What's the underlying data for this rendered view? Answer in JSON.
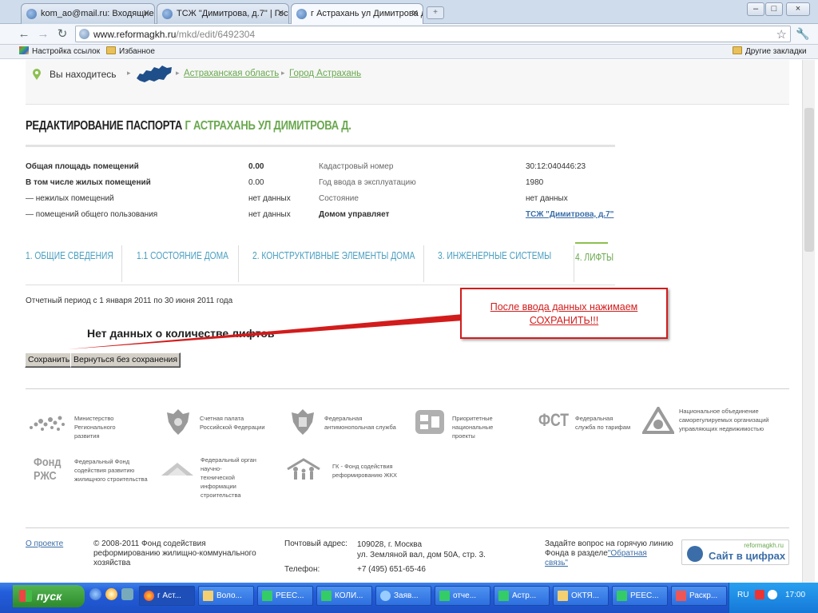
{
  "browser": {
    "tabs": [
      {
        "label": "kom_ao@mail.ru: Входящие"
      },
      {
        "label": "ТСЖ \"Димитрова, д.7\" | Госу"
      },
      {
        "label": "г Астрахань ул Димитрова д"
      }
    ],
    "url_host": "www.reformagkh.ru",
    "url_path": "/mkd/edit/6492304",
    "bookmarks": [
      {
        "label": "Настройка ссылок"
      },
      {
        "label": "Избанное"
      }
    ],
    "other_bookmarks": "Другие закладки",
    "window_buttons": [
      "–",
      "□",
      "×"
    ]
  },
  "breadcrumb": {
    "label": "Вы находитесь",
    "links": [
      "Астраханская область",
      "Город Астрахань"
    ]
  },
  "page": {
    "title_prefix": "РЕДАКТИРОВАНИЕ ПАСПОРТА",
    "title_address": "Г АСТРАХАНЬ УЛ ДИМИТРОВА Д.",
    "info_left": [
      {
        "label": "Общая площадь помещений",
        "value": "0.00",
        "bold": true
      },
      {
        "label": "В том числе жилых помещений",
        "value": "0.00",
        "bold": true
      },
      {
        "label": "— нежилых помещений",
        "value": "нет данных",
        "bold": false
      },
      {
        "label": "— помещений общего пользования",
        "value": "нет данных",
        "bold": false
      }
    ],
    "info_right": [
      {
        "label": "Кадастровый номер",
        "value": "30:12:040446:23"
      },
      {
        "label": "Год ввода в эксплуатацию",
        "value": "1980"
      },
      {
        "label": "Состояние",
        "value": "нет данных"
      },
      {
        "label": "Домом управляет",
        "value": "ТСЖ \"Димитрова, д.7\""
      }
    ],
    "tabs": [
      {
        "label": "1. ОБЩИЕ СВЕДЕНИЯ"
      },
      {
        "label": "1.1 СОСТОЯНИЕ ДОМА"
      },
      {
        "label": "2. КОНСТРУКТИВНЫЕ ЭЛЕМЕНТЫ ДОМА"
      },
      {
        "label": "3. ИНЖЕНЕРНЫЕ СИСТЕМЫ"
      },
      {
        "label": "4. ЛИФТЫ"
      }
    ],
    "period": "Отчетный период с 1 января 2011 по 30 июня 2011 года",
    "no_data": "Нет данных о количестве лифтов",
    "save_button": "Сохранить",
    "back_button": "Вернуться без сохранения"
  },
  "callout": {
    "line1": "После ввода данных нажимаем",
    "line2": "СОХРАНИТЬ!!!"
  },
  "partners": [
    {
      "lines": [
        "Министерство",
        "Регионального",
        "развития"
      ]
    },
    {
      "lines": [
        "Счетная палата",
        "Российской Федерации"
      ]
    },
    {
      "lines": [
        "Федеральная",
        "антимонопольная служба"
      ]
    },
    {
      "lines": [
        "Приоритетные",
        "национальные",
        "проекты"
      ]
    },
    {
      "lines": [
        "Федеральная",
        "служба по тарифам"
      ]
    },
    {
      "lines": [
        "Национальное объединение",
        "саморегулируемых организаций",
        "управляющих недвижимостью"
      ]
    },
    {
      "lines": [
        "Федеральный Фонд",
        "содействия развитию",
        "жилищного строительства"
      ]
    },
    {
      "lines": [
        "Федеральный орган",
        "научно-",
        "технической",
        "информации",
        "строительства"
      ]
    },
    {
      "lines": [
        "ГК - Фонд содействия",
        "реформированию ЖКХ"
      ]
    }
  ],
  "partner_logo_text": {
    "fst": "ФСТ",
    "rzhs": [
      "Фонд",
      "РЖС"
    ]
  },
  "footer": {
    "about": "О проекте",
    "copyright": [
      "© 2008-2011 Фонд содействия",
      "реформированию жилищно-коммунального",
      "хозяйства"
    ],
    "address_label": "Почтовый адрес:",
    "address": [
      "109028, г. Москва",
      "ул. Земляной вал, дом 50А, стр. 3."
    ],
    "phone_label": "Телефон:",
    "phone": "+7 (495) 651-65-46",
    "hotline": [
      "Задайте вопрос на горячую линию",
      "Фонда в разделе"
    ],
    "hotline_link_1": "\"Обратная",
    "hotline_link_2": "связь\"",
    "sayt_small": "reformagkh.ru",
    "sayt_big": "Сайт в цифрах"
  },
  "taskbar": {
    "start": "пуск",
    "tasks": [
      {
        "label": "г Аст..."
      },
      {
        "label": "Воло..."
      },
      {
        "label": "РЕЕС..."
      },
      {
        "label": "КОЛИ..."
      },
      {
        "label": "Заяв..."
      },
      {
        "label": "отче..."
      },
      {
        "label": "Астр..."
      },
      {
        "label": "ОКТЯ..."
      },
      {
        "label": "РЕЕС..."
      },
      {
        "label": "Раскр..."
      }
    ],
    "lang": "RU",
    "clock": "17:00"
  }
}
